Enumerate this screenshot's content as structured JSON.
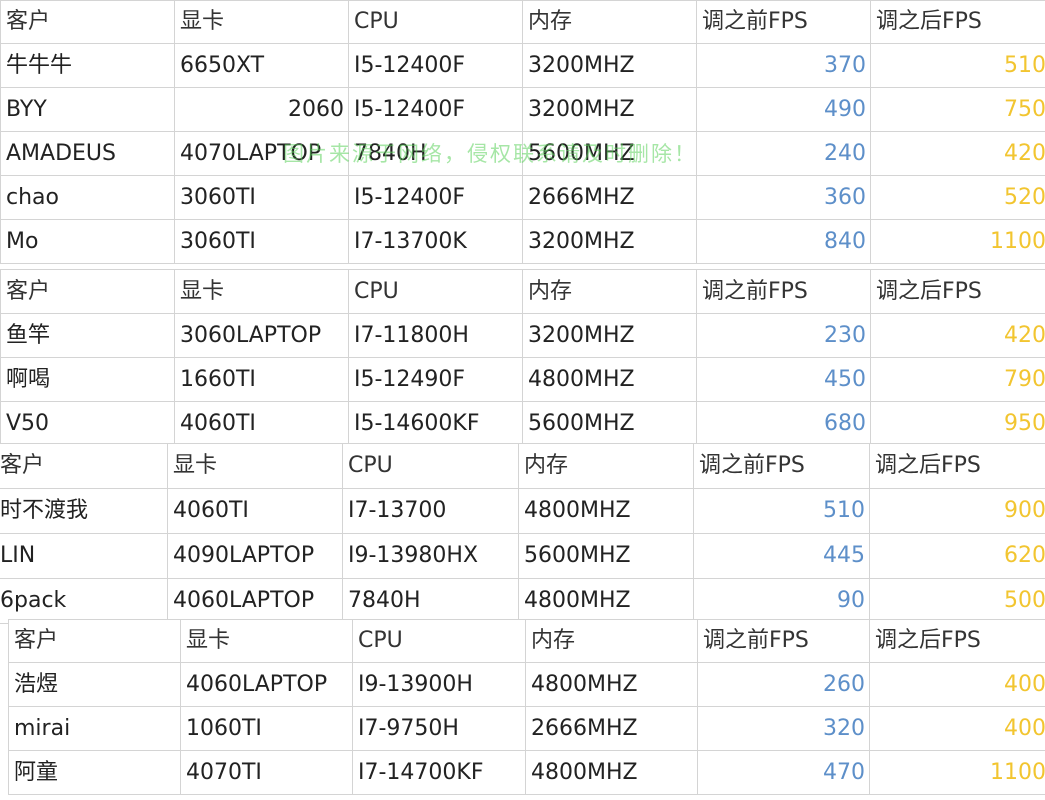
{
  "headers": [
    "客户",
    "显卡",
    "CPU",
    "内存",
    "调之前FPS",
    "调之后FPS"
  ],
  "tables": [
    {
      "rows": [
        [
          "牛牛牛",
          "6650XT",
          "I5-12400F",
          "3200MHZ",
          "370",
          "510"
        ],
        [
          "BYY",
          "2060",
          "I5-12400F",
          "3200MHZ",
          "490",
          "750"
        ],
        [
          "AMADEUS",
          "4070LAPTOP",
          "7840H",
          "5600MHZ",
          "240",
          "420"
        ],
        [
          "chao",
          "3060TI",
          "I5-12400F",
          "2666MHZ",
          "360",
          "520"
        ],
        [
          "Mo",
          "3060TI",
          "I7-13700K",
          "3200MHZ",
          "840",
          "1100"
        ]
      ]
    },
    {
      "rows": [
        [
          "鱼竿",
          "3060LAPTOP",
          "I7-11800H",
          "3200MHZ",
          "230",
          "420"
        ],
        [
          "啊喝",
          "1660TI",
          "I5-12490F",
          "4800MHZ",
          "450",
          "790"
        ],
        [
          "V50",
          "4060TI",
          "I5-14600KF",
          "5600MHZ",
          "680",
          "950"
        ]
      ]
    },
    {
      "rows": [
        [
          "时不渡我",
          "4060TI",
          "I7-13700",
          "4800MHZ",
          "510",
          "900"
        ],
        [
          "LIN",
          "4090LAPTOP",
          "I9-13980HX",
          "5600MHZ",
          "445",
          "620"
        ],
        [
          "6pack",
          "4060LAPTOP",
          "7840H",
          "4800MHZ",
          "90",
          "500"
        ]
      ]
    },
    {
      "rows": [
        [
          "浩煜",
          "4060LAPTOP",
          "I9-13900H",
          "4800MHZ",
          "260",
          "400"
        ],
        [
          "mirai",
          "1060TI",
          "I7-9750H",
          "2666MHZ",
          "320",
          "400"
        ],
        [
          "阿童",
          "4070TI",
          "I7-14700KF",
          "4800MHZ",
          "470",
          "1100"
        ]
      ]
    }
  ],
  "watermark": "图片来源于网络，侵权联系请及时删除！",
  "colors": {
    "before_fps": "#5d8fc9",
    "after_fps": "#f2c530",
    "grid": "#d4d4d4"
  }
}
